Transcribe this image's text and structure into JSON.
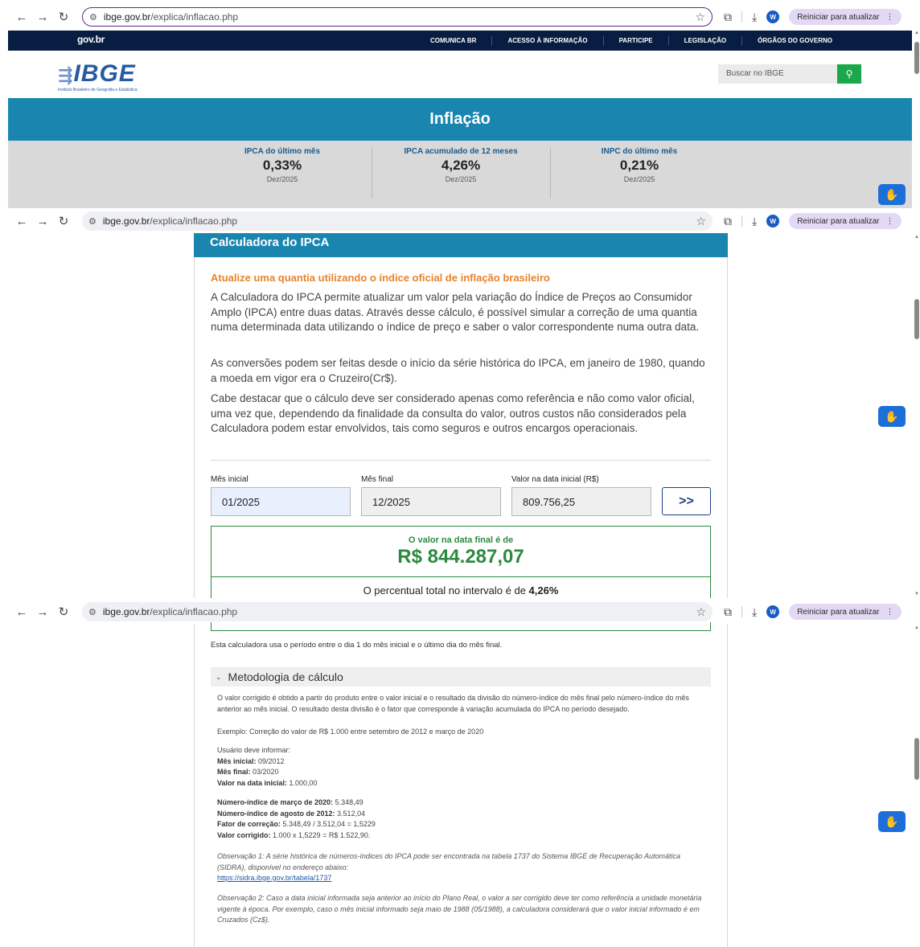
{
  "browser": {
    "host": "ibge.gov.br",
    "path": "/explica/inflacao.php",
    "profile_initial": "W",
    "update_label": "Reiniciar para atualizar"
  },
  "govbar": {
    "logo": "gov.br",
    "links": [
      "COMUNICA BR",
      "ACESSO À INFORMAÇÃO",
      "PARTICIPE",
      "LEGISLAÇÃO",
      "ÓRGÃOS DO GOVERNO"
    ]
  },
  "header": {
    "logo": "IBGE",
    "logo_sub": "Instituto Brasileiro de Geografia e Estatística",
    "search_placeholder": "Buscar no IBGE"
  },
  "banner": {
    "title": "Inflação"
  },
  "stats": [
    {
      "label": "IPCA do último mês",
      "value": "0,33%",
      "period": "Dez/2025"
    },
    {
      "label": "IPCA acumulado de 12 meses",
      "value": "4,26%",
      "period": "Dez/2025"
    },
    {
      "label": "INPC do último mês",
      "value": "0,21%",
      "period": "Dez/2025"
    }
  ],
  "calculator": {
    "title": "Calculadora do IPCA",
    "subtitle": "Atualize uma quantia utilizando o índice oficial de inflação brasileiro",
    "p1": "A Calculadora do IPCA permite atualizar um valor pela variação do Índice de Preços ao Consumidor Amplo (IPCA) entre duas datas. Através desse cálculo, é possível simular a correção de uma quantia numa determinada data utilizando o índice de preço e saber o valor correspondente numa outra data.",
    "p2": "As conversões podem ser feitas desde o início da série histórica do IPCA, em janeiro de 1980, quando a moeda em vigor era o Cruzeiro(Cr$).",
    "p3": "Cabe destacar que o cálculo deve ser considerado apenas como referência e não como valor oficial, uma vez que, dependendo da finalidade da consulta do valor, outros custos não considerados pela Calculadora podem estar envolvidos, tais como seguros e outros encargos operacionais.",
    "start_label": "Mês inicial",
    "start_value": "01/2025",
    "end_label": "Mês final",
    "end_value": "12/2025",
    "amount_label": "Valor na data inicial (R$)",
    "amount_value": "809.756,25",
    "submit_label": ">>",
    "result_label": "O valor na data final é de",
    "result_value": "R$ 844.287,07",
    "percent_prefix": "O percentual total no intervalo é de ",
    "percent_value": "4,26%",
    "note": "Esta calculadora usa o período entre o dia 1 do mês inicial e o último dia do mês final."
  },
  "methodology": {
    "title": "Metodologia de cálculo",
    "intro": "O valor corrigido é obtido a partir do produto entre o valor inicial e o resultado da divisão do número-índice do mês final pelo número-índice do mês anterior ao mês inicial. O resultado desta divisão é o fator que corresponde à variação acumulada do IPCA no período desejado.",
    "example": "Exemplo: Correção do valor de R$ 1.000 entre setembro de 2012 e março de 2020",
    "user_must": "Usuário deve informar:",
    "inputs": [
      {
        "k": "Mês inicial:",
        "v": " 09/2012"
      },
      {
        "k": "Mês final:",
        "v": " 03/2020"
      },
      {
        "k": "Valor na data inicial:",
        "v": " 1.000,00"
      }
    ],
    "calc": [
      {
        "k": "Número-índice de março de 2020:",
        "v": " 5.348,49"
      },
      {
        "k": "Número-índice de agosto de 2012:",
        "v": " 3.512,04"
      },
      {
        "k": "Fator de correção:",
        "v": " 5.348,49 / 3.512,04 = 1,5229"
      },
      {
        "k": "Valor corrigido:",
        "v": " 1.000 x 1,5229 = R$ 1.522,90."
      }
    ],
    "obs1": "Observação 1: A série histórica de números-índices do IPCA pode ser encontrada na tabela 1737 do Sistema IBGE de Recuperação Automática (SIDRA), disponível no endereço abaixo:",
    "obs1_link": "https://sidra.ibge.gov.br/tabela/1737",
    "obs2": "Observação 2: Caso a data inicial informada seja anterior ao início do Plano Real, o valor a ser corrigido deve ter como referência a unidade monetária vigente à época. Por exemplo, caso o mês inicial informado seja maio de 1988 (05/1988), a calculadora considerará que o valor inicial informado é em Cruzados (Cz$)."
  }
}
